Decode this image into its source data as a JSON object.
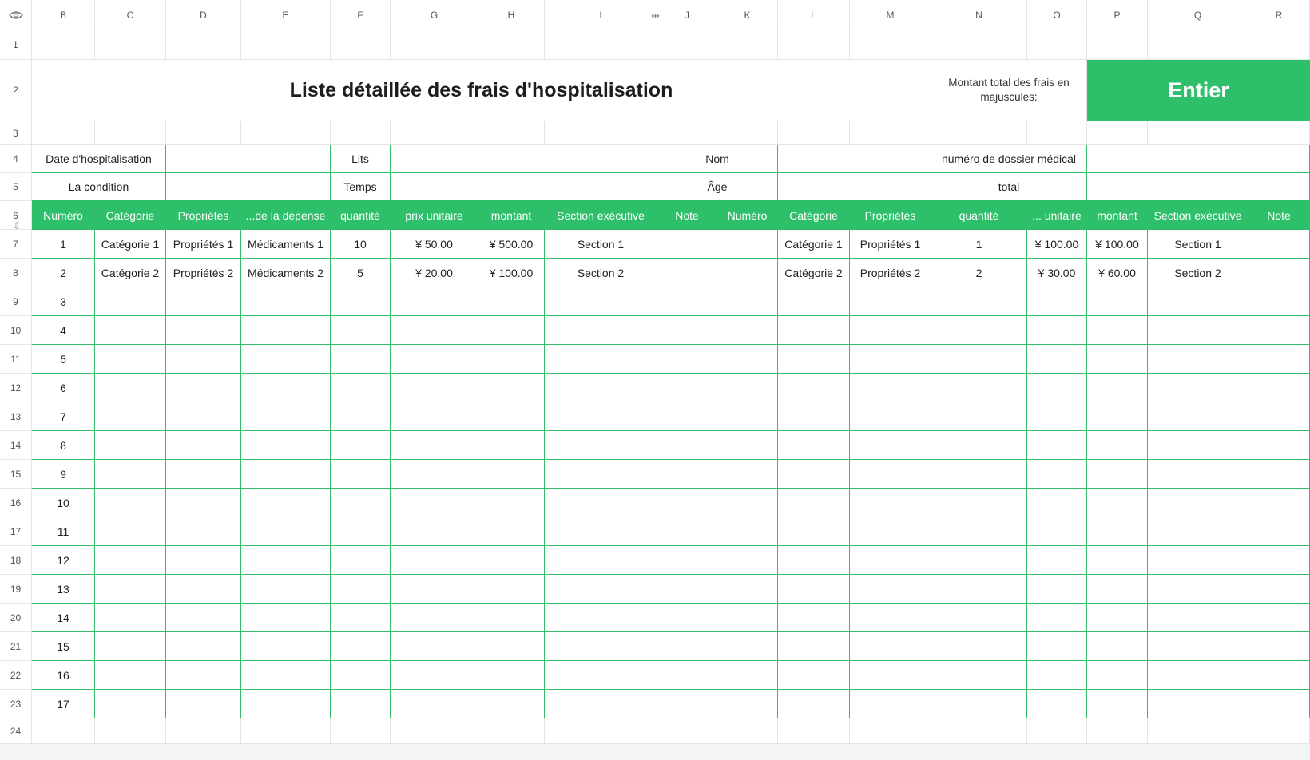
{
  "sheet": {
    "columns": [
      "B",
      "C",
      "D",
      "E",
      "F",
      "G",
      "H",
      "I",
      "J",
      "K",
      "L",
      "M",
      "N",
      "O",
      "P",
      "Q",
      "R"
    ],
    "row_numbers": [
      "1",
      "2",
      "3",
      "4",
      "5",
      "6",
      "7",
      "8",
      "9",
      "10",
      "11",
      "12",
      "13",
      "14",
      "15",
      "16",
      "17",
      "18",
      "19",
      "20",
      "21",
      "22",
      "23",
      "24"
    ],
    "title": "Liste détaillée des frais d'hospitalisation",
    "total_label": "Montant total des frais en majuscules:",
    "total_value": "Entier",
    "info": {
      "row4": {
        "date_label": "Date d'hospitalisation",
        "lits_label": "Lits",
        "nom_label": "Nom",
        "dossier_label": "numéro de dossier médical"
      },
      "row5": {
        "condition_label": "La condition",
        "temps_label": "Temps",
        "age_label": "Âge",
        "total_label": "total"
      }
    },
    "headers": [
      "Numéro",
      "Catégorie",
      "Propriétés",
      "...de la dépense",
      "quantité",
      "prix unitaire",
      "montant",
      "Section exécutive",
      "Note",
      "Numéro",
      "Catégorie",
      "Propriétés",
      "quantité",
      "... unitaire",
      "montant",
      "Section exécutive",
      "Note"
    ],
    "data_rows": [
      [
        "1",
        "Catégorie 1",
        "Propriétés 1",
        "Médicaments 1",
        "10",
        "¥ 50.00",
        "¥ 500.00",
        "Section 1",
        "",
        "",
        "Catégorie 1",
        "Propriétés 1",
        "1",
        "¥ 100.00",
        "¥ 100.00",
        "Section 1",
        ""
      ],
      [
        "2",
        "Catégorie 2",
        "Propriétés 2",
        "Médicaments 2",
        "5",
        "¥ 20.00",
        "¥ 100.00",
        "Section 2",
        "",
        "",
        "Catégorie 2",
        "Propriétés 2",
        "2",
        "¥ 30.00",
        "¥ 60.00",
        "Section 2",
        ""
      ]
    ],
    "numbers": [
      "3",
      "4",
      "5",
      "6",
      "7",
      "8",
      "9",
      "10",
      "11",
      "12",
      "13",
      "14",
      "15",
      "16",
      "17"
    ]
  },
  "icons": {
    "corner": "eye-icon",
    "column_resize": "column-resize-icon",
    "row_resize": "row-resize-icon"
  },
  "colors": {
    "accent": "#2ebf6b",
    "grid_green": "#31bd6a"
  }
}
